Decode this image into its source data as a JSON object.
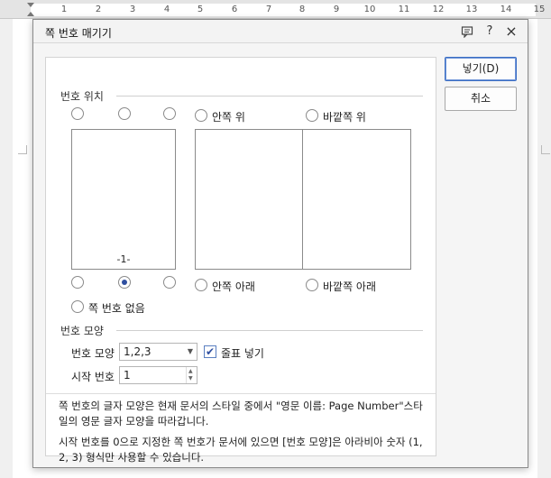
{
  "ruler": {
    "numbers": [
      "1",
      "2",
      "3",
      "4",
      "5",
      "6",
      "7",
      "8",
      "9",
      "10",
      "11",
      "12",
      "13",
      "14",
      "15"
    ]
  },
  "dialog": {
    "title": "쪽 번호 매기기",
    "help_icon_label": "?",
    "close_icon_label": "×",
    "memo_icon": "comment-icon"
  },
  "position_section": {
    "title": "번호 위치",
    "options": {
      "inner_top": "안쪽 위",
      "outer_top": "바깥쪽 위",
      "inner_bottom": "안쪽 아래",
      "outer_bottom": "바깥쪽 아래",
      "none": "쪽 번호 없음"
    },
    "selected": "bottom-center",
    "preview_number": "-1-"
  },
  "format_section": {
    "title": "번호 모양",
    "format_label": "번호 모양",
    "format_value": "1,2,3",
    "dash_checkbox_label": "줄표 넣기",
    "dash_checked": true,
    "start_label": "시작 번호",
    "start_value": "1"
  },
  "notes": {
    "note1": "쪽 번호의 글자 모양은 현재 문서의 스타일 중에서 \"영문 이름: Page Number\"스타일의 영문 글자 모양을 따라갑니다.",
    "note2": "시작 번호를 0으로 지정한 쪽 번호가 문서에 있으면 [번호 모양]은 아라비아 숫자 (1, 2, 3) 형식만 사용할 수 있습니다."
  },
  "buttons": {
    "insert": "넣기(D)",
    "cancel": "취소"
  },
  "colors": {
    "accent": "#2f4fa0",
    "default_button_border": "#3d6fc4"
  }
}
